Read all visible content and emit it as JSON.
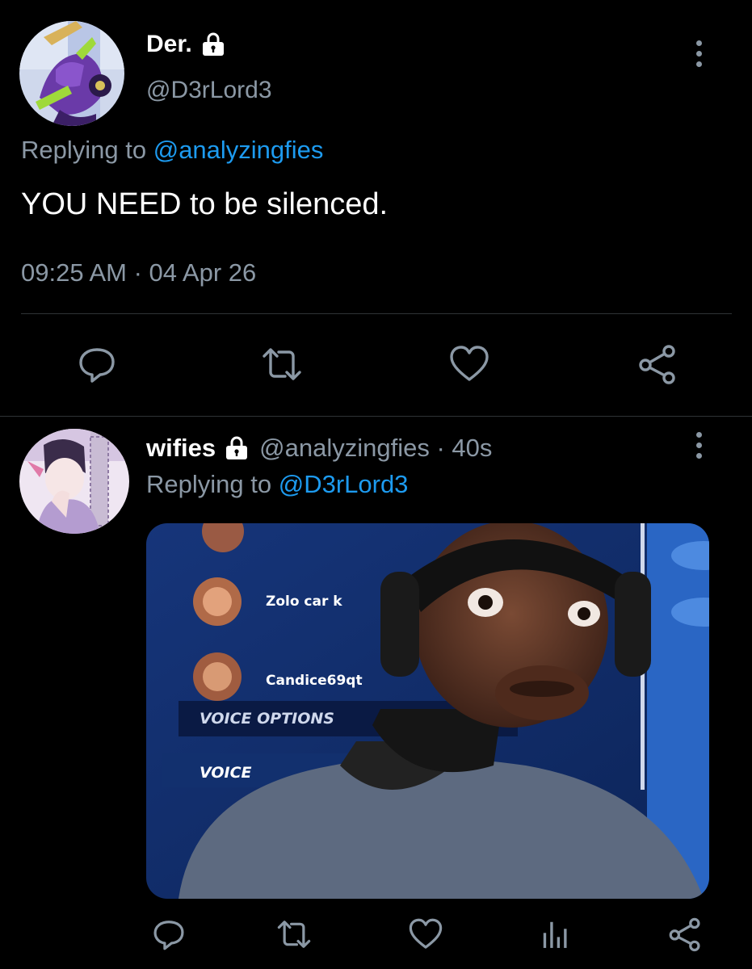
{
  "tweet1": {
    "display_name": "Der.",
    "handle": "@D3rLord3",
    "replying_prefix": "Replying to ",
    "replying_handle": "@analyzingfies",
    "text": "YOU NEED to be silenced.",
    "timestamp": "09:25 AM · 04 Apr 26",
    "actions": [
      "reply-icon",
      "retweet-icon",
      "like-icon",
      "share-icon"
    ]
  },
  "tweet2": {
    "display_name": "wifies",
    "handle": "@analyzingfies",
    "separator": " · ",
    "age": "40s",
    "replying_prefix": "Replying to ",
    "replying_handle": "@D3rLord3",
    "media": {
      "players": [
        "Zolo car k",
        "Candice69qt"
      ],
      "menu_heading": "VOICE OPTIONS",
      "menu_item": "VOICE"
    },
    "actions": [
      "reply-icon",
      "retweet-icon",
      "like-icon",
      "analytics-icon",
      "share-icon"
    ]
  },
  "colors": {
    "background": "#000000",
    "text": "#e7e9ea",
    "secondary": "#8b98a5",
    "link": "#1d9bf0",
    "divider": "#2f3336"
  }
}
